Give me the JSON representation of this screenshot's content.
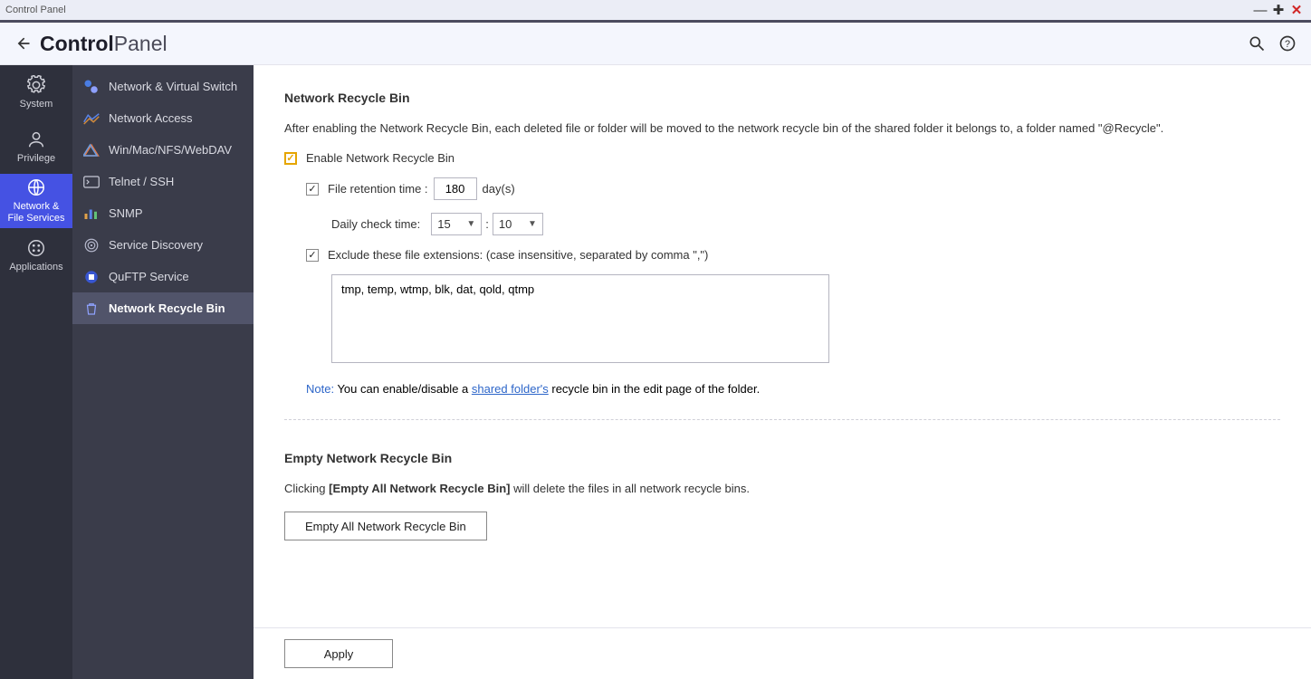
{
  "window": {
    "title": "Control Panel"
  },
  "header": {
    "app_bold": "Control",
    "app_light": "Panel"
  },
  "rail": {
    "system": "System",
    "privilege": "Privilege",
    "network": "Network &\nFile Services",
    "applications": "Applications"
  },
  "submenu": {
    "items": [
      {
        "label": "Network & Virtual Switch"
      },
      {
        "label": "Network Access"
      },
      {
        "label": "Win/Mac/NFS/WebDAV"
      },
      {
        "label": "Telnet / SSH"
      },
      {
        "label": "SNMP"
      },
      {
        "label": "Service Discovery"
      },
      {
        "label": "QuFTP Service"
      },
      {
        "label": "Network Recycle Bin"
      }
    ]
  },
  "main": {
    "section1_title": "Network Recycle Bin",
    "section1_desc": "After enabling the Network Recycle Bin, each deleted file or folder will be moved to the network recycle bin of the shared folder it belongs to, a folder named \"@Recycle\".",
    "enable_label": "Enable Network Recycle Bin",
    "retention_label": "File retention time :",
    "retention_value": "180",
    "retention_unit": "day(s)",
    "check_label": "Daily check time:",
    "check_hour": "15",
    "check_sep": ":",
    "check_min": "10",
    "exclude_label": "Exclude these file extensions: (case insensitive, separated by comma \",\")",
    "exclude_value": "tmp, temp, wtmp, blk, dat, qold, qtmp",
    "note_label": "Note:",
    "note_before": " You can enable/disable a ",
    "note_link": "shared folder's",
    "note_after": " recycle bin in the edit page of the folder.",
    "section2_title": "Empty Network Recycle Bin",
    "section2_before": "Clicking ",
    "section2_bold": "[Empty All Network Recycle Bin]",
    "section2_after": " will delete the files in all network recycle bins.",
    "empty_btn": "Empty All Network Recycle Bin",
    "apply_btn": "Apply"
  }
}
